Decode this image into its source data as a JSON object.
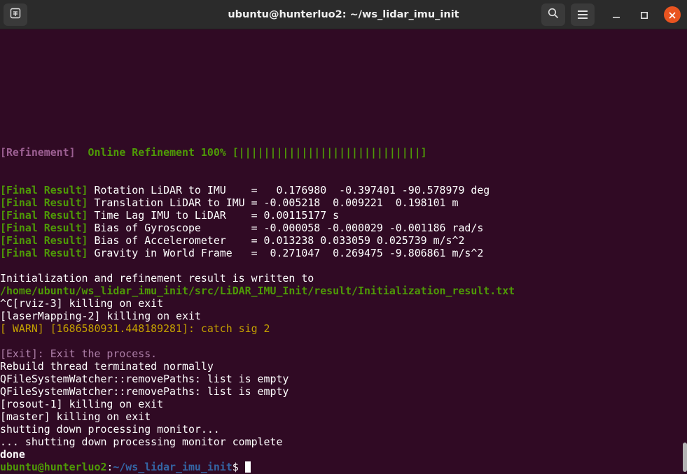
{
  "window": {
    "title": "ubuntu@hunterluo2: ~/ws_lidar_imu_init",
    "icons": {
      "new_tab": "new-tab-icon",
      "search": "search-icon",
      "menu": "hamburger-menu-icon",
      "minimize": "minimize-icon",
      "maximize": "maximize-icon",
      "close": "close-icon"
    }
  },
  "colors": {
    "background": "#300a24",
    "titlebar": "#2b2b2b",
    "close_button": "#e95420",
    "green": "#4e9a06",
    "yellow": "#c4a000",
    "prompt_path": "#8ae234"
  },
  "terminal": {
    "refinement": {
      "tag": "[Refinement]",
      "text": "  Online Refinement 100% [|||||||||||||||||||||||||||||]"
    },
    "final_result_tag": "[Final Result]",
    "final_results": [
      " Rotation LiDAR to IMU    =   0.176980  -0.397401 -90.578979 deg",
      " Translation LiDAR to IMU = -0.005218  0.009221  0.198101 m",
      " Time Lag IMU to LiDAR    = 0.00115177 s",
      " Bias of Gyroscope        = -0.000058 -0.000029 -0.001186 rad/s",
      " Bias of Accelerometer    = 0.013238 0.033059 0.025739 m/s^2",
      " Gravity in World Frame   =  0.271047  0.269475 -9.806861 m/s^2"
    ],
    "written_to": "Initialization and refinement result is written to",
    "result_path": "/home/ubuntu/ws_lidar_imu_init/src/LiDAR_IMU_Init/result/Initialization_result.txt",
    "rviz_kill": "^C[rviz-3] killing on exit",
    "laser_kill": "[laserMapping-2] killing on exit",
    "warn": "[ WARN] [1686580931.448189281]: catch sig 2",
    "exit_line": "[Exit]: Exit the process.",
    "rebuild": "Rebuild thread terminated normally",
    "qfs1": "QFileSystemWatcher::removePaths: list is empty",
    "qfs2": "QFileSystemWatcher::removePaths: list is empty",
    "rosout": "[rosout-1] killing on exit",
    "master": "[master] killing on exit",
    "shutdown1": "shutting down processing monitor...",
    "shutdown2": "... shutting down processing monitor complete",
    "done": "done",
    "prompt": {
      "user_host": "ubuntu@hunterluo2",
      "colon": ":",
      "path": "~/ws_lidar_imu_init",
      "symbol": "$ "
    }
  }
}
